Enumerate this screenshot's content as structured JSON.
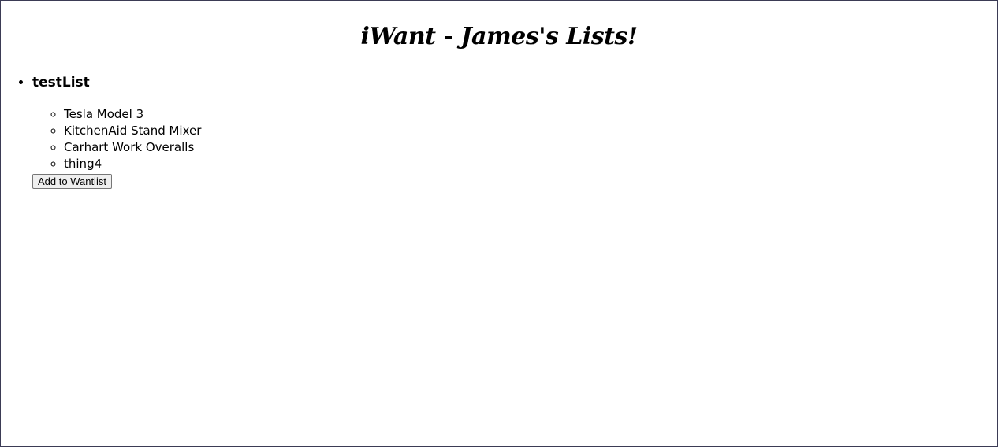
{
  "page": {
    "title": "iWant - James's Lists!"
  },
  "lists": [
    {
      "name": "testList",
      "items": [
        "Tesla Model 3",
        "KitchenAid Stand Mixer",
        "Carhart Work Overalls",
        "thing4"
      ],
      "add_button_label": "Add to Wantlist"
    }
  ]
}
